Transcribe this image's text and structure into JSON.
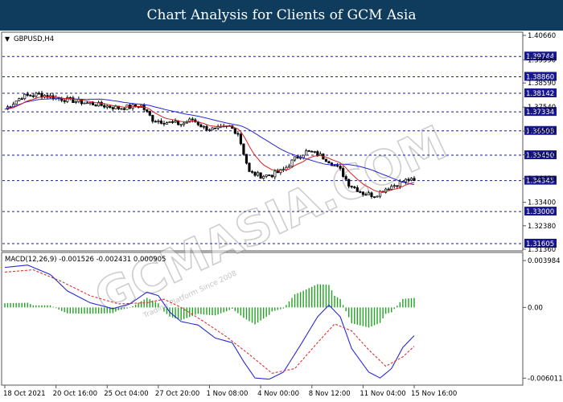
{
  "header": {
    "title": "Chart Analysis for Clients of GCM Asia"
  },
  "watermark": {
    "main": "GCMASIA.COM",
    "sub": "Trading Platform Since 2008"
  },
  "colors": {
    "header_bg": "#0f3c5c",
    "ma_fast": "#d62020",
    "ma_slow": "#2727d6",
    "level_line": "#1a1a99",
    "level_label_bg": "#18188c",
    "macd_hist": "#21a121",
    "macd_line": "#2a2ad8",
    "macd_signal": "#e03030"
  },
  "chart_data": {
    "type": "candlestick",
    "symbol_label": "GBPUSD,H4",
    "price_axis": {
      "ylim": [
        1.3136,
        1.4066
      ],
      "tick_labels": [
        "1.40660",
        "1.39590",
        "1.38590",
        "1.37540",
        "1.36500",
        "1.35470",
        "1.34430",
        "1.33400",
        "1.32380",
        "1.31360"
      ]
    },
    "levels": [
      {
        "label": "1.39744",
        "value": 1.39744
      },
      {
        "label": "1.38860",
        "value": 1.3886
      },
      {
        "label": "1.38142",
        "value": 1.38142
      },
      {
        "label": "1.37334",
        "value": 1.37334
      },
      {
        "label": "1.36508",
        "value": 1.36508
      },
      {
        "label": "1.35450",
        "value": 1.3545
      },
      {
        "label": "1.34345",
        "value": 1.34345
      },
      {
        "label": "1.33000",
        "value": 1.33
      },
      {
        "label": "1.31605",
        "value": 1.31605
      }
    ],
    "close_key": [
      [
        0,
        1.3745
      ],
      [
        6,
        1.38
      ],
      [
        12,
        1.381
      ],
      [
        20,
        1.379
      ],
      [
        30,
        1.377
      ],
      [
        40,
        1.375
      ],
      [
        48,
        1.376
      ],
      [
        52,
        1.37
      ],
      [
        56,
        1.369
      ],
      [
        62,
        1.368
      ],
      [
        66,
        1.37
      ],
      [
        70,
        1.3665
      ],
      [
        74,
        1.3655
      ],
      [
        79,
        1.367
      ],
      [
        82,
        1.364
      ],
      [
        86,
        1.347
      ],
      [
        90,
        1.3455
      ],
      [
        94,
        1.346
      ],
      [
        98,
        1.348
      ],
      [
        102,
        1.353
      ],
      [
        106,
        1.356
      ],
      [
        110,
        1.355
      ],
      [
        114,
        1.352
      ],
      [
        118,
        1.348
      ],
      [
        121,
        1.342
      ],
      [
        126,
        1.338
      ],
      [
        130,
        1.337
      ],
      [
        134,
        1.34
      ],
      [
        138,
        1.342
      ],
      [
        142,
        1.344
      ],
      [
        144,
        1.343
      ]
    ],
    "candle_count": 145,
    "x_ticks": [
      "18 Oct 2021",
      "20 Oct 16:00",
      "25 Oct 04:00",
      "27 Oct 20:00",
      "1 Nov 08:00",
      "4 Nov 00:00",
      "8 Nov 12:00",
      "11 Nov 04:00",
      "15 Nov 16:00"
    ],
    "macd": {
      "label": "MACD(12,26,9) -0.001526 -0.002431 0.000905",
      "ylim": [
        -0.0064,
        0.0044
      ],
      "tick_labels": [
        "0.003984",
        "0.00",
        "-0.006011"
      ],
      "main_key": [
        [
          0,
          0.0034
        ],
        [
          8,
          0.0036
        ],
        [
          16,
          0.0028
        ],
        [
          22,
          0.0014
        ],
        [
          30,
          0.0004
        ],
        [
          38,
          -0.0001
        ],
        [
          44,
          0.0003
        ],
        [
          50,
          0.0013
        ],
        [
          54,
          0.001
        ],
        [
          58,
          -0.0004
        ],
        [
          62,
          -0.0012
        ],
        [
          68,
          -0.0015
        ],
        [
          74,
          -0.0026
        ],
        [
          80,
          -0.003
        ],
        [
          84,
          -0.0046
        ],
        [
          88,
          -0.006
        ],
        [
          93,
          -0.0061
        ],
        [
          98,
          -0.0055
        ],
        [
          104,
          -0.0032
        ],
        [
          110,
          -0.0008
        ],
        [
          114,
          0.0002
        ],
        [
          118,
          -0.0008
        ],
        [
          122,
          -0.0035
        ],
        [
          128,
          -0.0055
        ],
        [
          132,
          -0.006
        ],
        [
          136,
          -0.0052
        ],
        [
          140,
          -0.0034
        ],
        [
          144,
          -0.0024
        ]
      ],
      "signal_key": [
        [
          0,
          0.003
        ],
        [
          10,
          0.0032
        ],
        [
          20,
          0.0022
        ],
        [
          30,
          0.001
        ],
        [
          40,
          0.0003
        ],
        [
          50,
          0.0004
        ],
        [
          56,
          0.0007
        ],
        [
          62,
          0.0
        ],
        [
          70,
          -0.0012
        ],
        [
          78,
          -0.0025
        ],
        [
          86,
          -0.004
        ],
        [
          94,
          -0.0056
        ],
        [
          102,
          -0.0052
        ],
        [
          110,
          -0.003
        ],
        [
          116,
          -0.0014
        ],
        [
          122,
          -0.002
        ],
        [
          128,
          -0.0036
        ],
        [
          134,
          -0.005
        ],
        [
          140,
          -0.0042
        ],
        [
          144,
          -0.0033
        ]
      ]
    }
  }
}
